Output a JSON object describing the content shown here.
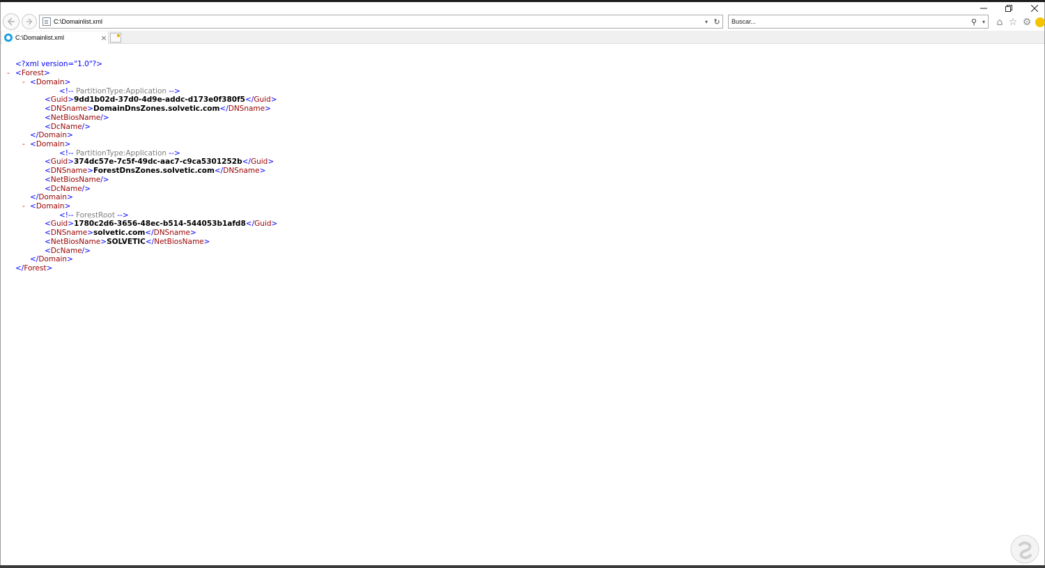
{
  "browser": {
    "address_url": "C:\\Domainlist.xml",
    "search_placeholder": "Buscar...",
    "tab_title": "C:\\Domainlist.xml"
  },
  "xml": {
    "declaration": "<?xml version=\"1.0\"?>",
    "root_tag": "Forest",
    "domains": [
      {
        "comment": "PartitionType:Application",
        "guid": "9dd1b02d-37d0-4d9e-addc-d173e0f380f5",
        "dnsname": "DomainDnsZones.solvetic.com",
        "netbiosname": "",
        "dcname": ""
      },
      {
        "comment": "PartitionType:Application",
        "guid": "374dc57e-7c5f-49dc-aac7-c9ca5301252b",
        "dnsname": "ForestDnsZones.solvetic.com",
        "netbiosname": "",
        "dcname": ""
      },
      {
        "comment": "ForestRoot",
        "guid": "1780c2d6-3656-48ec-b514-544053b1afd8",
        "dnsname": "solvetic.com",
        "netbiosname": "SOLVETIC",
        "dcname": ""
      }
    ]
  }
}
